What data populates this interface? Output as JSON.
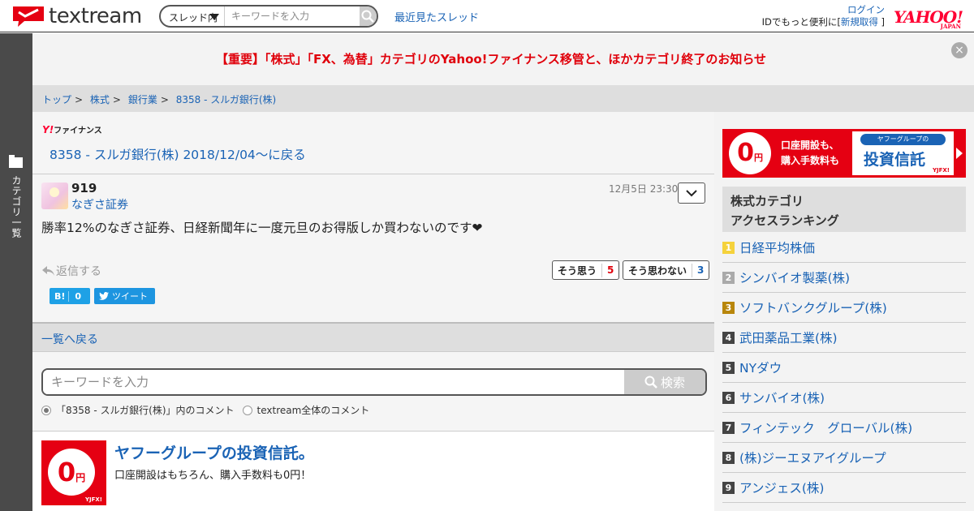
{
  "header": {
    "logo_text": "textream",
    "scope_select": "スレッド内",
    "search_placeholder": "キーワードを入力",
    "recent_threads": "最近見たスレッド",
    "login": "ログイン",
    "id_promo": "IDでもっと便利に[",
    "signup": "新規取得",
    "signup_close": " ]",
    "yahoo_logo": "YAHOO!",
    "yahoo_sub": "JAPAN"
  },
  "category_bar": {
    "label": "カテゴリ一覧"
  },
  "notice": {
    "text": "【重要】「株式」「FX、為替」カテゴリのYahoo!ファイナンス移管と、ほかカテゴリ終了のお知らせ",
    "close": "×"
  },
  "breadcrumb": [
    "トップ",
    "株式",
    "銀行業",
    "8358 - スルガ銀行(株)"
  ],
  "breadcrumb_sep": ">",
  "main": {
    "yf_logo_y": "Y!",
    "yf_logo_text": "ファイナンス",
    "back_link": "8358 - スルガ銀行(株) 2018/12/04〜に戻る",
    "post": {
      "number": "919",
      "author": "なぎさ証券",
      "time": "12月5日 23:30",
      "body": "勝率12%のなぎさ証券、日経新聞年に一度元旦のお得版しか買わないのです❤",
      "reply_label": "返信する",
      "agree_label": "そう思う",
      "agree_count": "5",
      "disagree_label": "そう思わない",
      "disagree_count": "3",
      "hatebu_label": "B!",
      "hatebu_count": "0",
      "tweet_label": "ツイート"
    },
    "back_to_list": "一覧へ戻る",
    "search": {
      "placeholder": "キーワードを入力",
      "button": "検索",
      "radio_in_thread": "「8358 - スルガ銀行(株)」内のコメント",
      "radio_all": "textream全体のコメント"
    },
    "ad": {
      "zero": "0",
      "yen": "円",
      "brand": "YJFX!",
      "title": "ヤフーグループの投資信託。",
      "desc": "口座開設はもちろん、購入手数料も0円！"
    }
  },
  "sidebar": {
    "banner": {
      "zero": "0",
      "yen": "円",
      "line1": "口座開設も、",
      "line2": "購入手数料も",
      "pill": "ヤフーグループの",
      "main": "投資信託",
      "brand": "YJFX!"
    },
    "ranking_title_1": "株式カテゴリ",
    "ranking_title_2": "アクセスランキング",
    "ranking": [
      {
        "rank": "1",
        "name": "日経平均株価"
      },
      {
        "rank": "2",
        "name": "シンバイオ製薬(株)"
      },
      {
        "rank": "3",
        "name": "ソフトバンクグループ(株)"
      },
      {
        "rank": "4",
        "name": "武田薬品工業(株)"
      },
      {
        "rank": "5",
        "name": "NYダウ"
      },
      {
        "rank": "6",
        "name": "サンバイオ(株)"
      },
      {
        "rank": "7",
        "name": "フィンテック　グローバル(株)"
      },
      {
        "rank": "8",
        "name": "(株)ジーエヌアイグループ"
      },
      {
        "rank": "9",
        "name": "アンジェス(株)"
      }
    ]
  },
  "colors": {
    "accent_link": "#1a63b5",
    "notice_red": "#e0000b",
    "brand_red": "#e50012"
  }
}
